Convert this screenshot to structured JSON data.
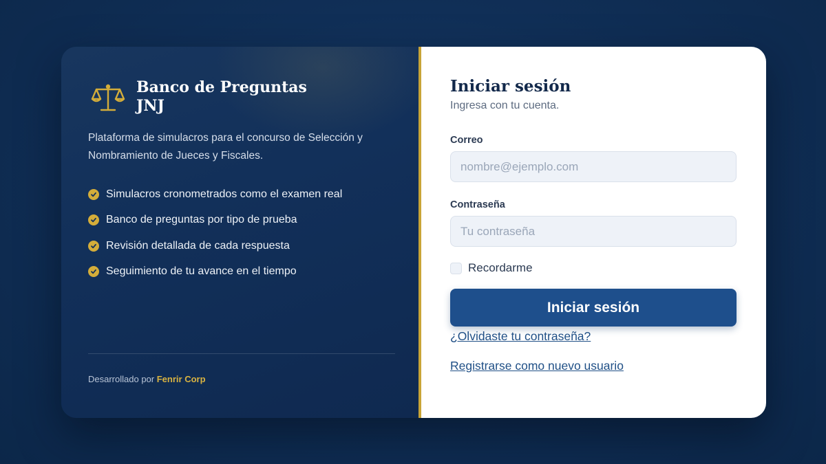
{
  "brand": {
    "icon": "balance-scale-icon",
    "title_line1": "Banco de Preguntas",
    "title_line2": "JNJ",
    "description": "Plataforma de simulacros para el concurso de Selección y Nombramiento de Jueces y Fiscales."
  },
  "features": [
    "Simulacros cronometrados como el examen real",
    "Banco de preguntas por tipo de prueba",
    "Revisión detallada de cada respuesta",
    "Seguimiento de tu avance en el tiempo"
  ],
  "footer": {
    "prefix": "Desarrollado por",
    "company": "Fenrir Corp"
  },
  "login": {
    "title": "Iniciar sesión",
    "subtitle": "Ingresa con tu cuenta.",
    "email_label": "Correo",
    "email_placeholder": "nombre@ejemplo.com",
    "email_value": "",
    "password_label": "Contraseña",
    "password_placeholder": "Tu contraseña",
    "password_value": "",
    "remember_label": "Recordarme",
    "remember_checked": false,
    "submit_label": "Iniciar sesión",
    "forgot_link": "¿Olvidaste tu contraseña?",
    "register_link": "Registrarse como nuevo usuario"
  },
  "colors": {
    "accent_gold": "#c9a537",
    "primary_button": "#1e4f8c",
    "panel_dark": "#12305a"
  }
}
